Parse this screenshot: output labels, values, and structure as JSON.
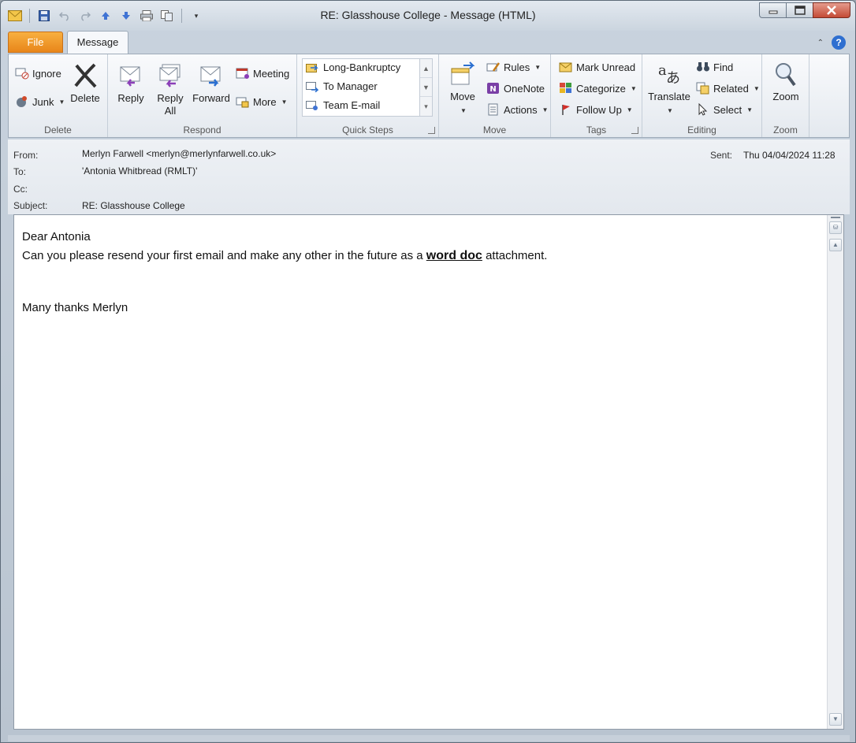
{
  "window": {
    "title": "RE: Glasshouse College  -  Message (HTML)"
  },
  "tabs": {
    "file": "File",
    "message": "Message"
  },
  "ribbon": {
    "delete_group": {
      "label": "Delete",
      "ignore": "Ignore",
      "junk": "Junk",
      "delete": "Delete"
    },
    "respond_group": {
      "label": "Respond",
      "reply": "Reply",
      "reply_all_1": "Reply",
      "reply_all_2": "All",
      "forward": "Forward",
      "meeting": "Meeting",
      "more": "More"
    },
    "quicksteps_group": {
      "label": "Quick Steps",
      "items": [
        "Long-Bankruptcy",
        "To Manager",
        "Team E-mail"
      ]
    },
    "move_group": {
      "label": "Move",
      "move": "Move",
      "rules": "Rules",
      "onenote": "OneNote",
      "actions": "Actions"
    },
    "tags_group": {
      "label": "Tags",
      "mark_unread": "Mark Unread",
      "categorize": "Categorize",
      "follow_up": "Follow Up"
    },
    "editing_group": {
      "label": "Editing",
      "translate": "Translate",
      "find": "Find",
      "related": "Related",
      "select": "Select"
    },
    "zoom_group": {
      "label": "Zoom",
      "zoom": "Zoom"
    }
  },
  "header": {
    "from_label": "From:",
    "from_value": "Merlyn Farwell <merlyn@merlynfarwell.co.uk>",
    "to_label": "To:",
    "to_value": "'Antonia Whitbread (RMLT)'",
    "cc_label": "Cc:",
    "subject_label": "Subject:",
    "subject_value": "RE: Glasshouse College",
    "sent_label": "Sent:",
    "sent_value": "Thu 04/04/2024 11:28"
  },
  "body": {
    "greeting": "Dear Antonia",
    "line_pre": "Can you please resend your first email and make any other in the future as a ",
    "line_emph": "word doc",
    "line_post": " attachment.",
    "signoff": "Many thanks Merlyn"
  },
  "colors": {
    "file_tab": "#e8861a",
    "close_button": "#c44b36",
    "help": "#2f6fd0"
  }
}
